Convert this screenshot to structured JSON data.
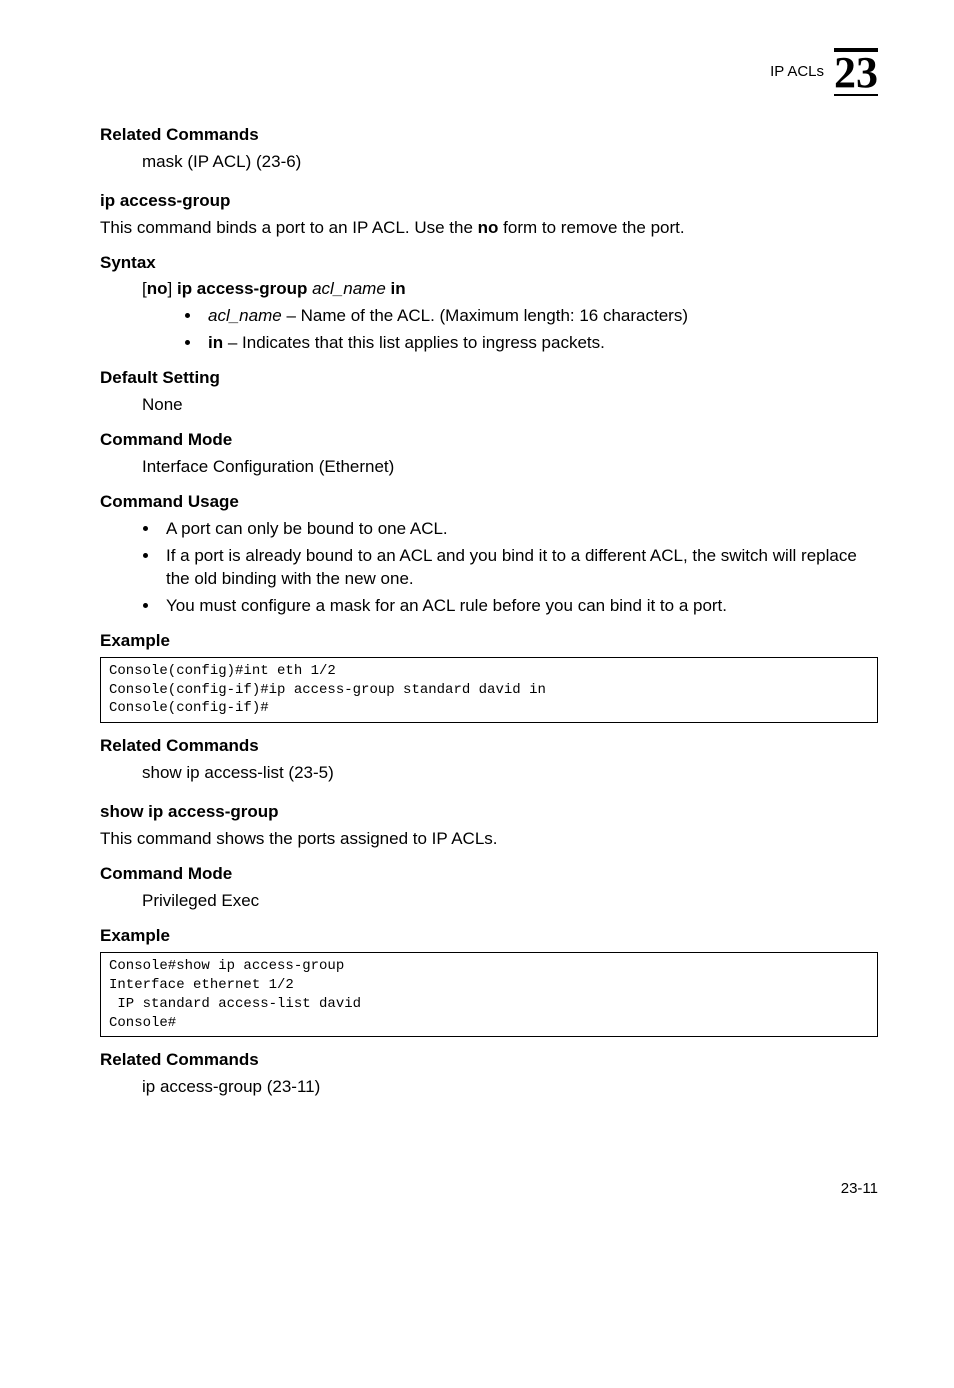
{
  "header": {
    "label": "IP ACLs",
    "chapter": "23"
  },
  "sections": {
    "rc1": {
      "title": "Related Commands",
      "body": "mask (IP ACL) (23-6)"
    },
    "iag": {
      "title": "ip access-group",
      "intro_a": "This command binds a port to an IP ACL. Use the ",
      "intro_b": "no",
      "intro_c": " form to remove the port."
    },
    "syntax": {
      "title": "Syntax",
      "line_prefix": "[",
      "line_no": "no",
      "line_mid1": "] ",
      "line_cmd": "ip access-group",
      "line_arg": " acl_name ",
      "line_in": "in",
      "b1_name": "acl_name",
      "b1_rest": " – Name of the ACL. (Maximum length: 16 characters)",
      "b2_in": "in",
      "b2_rest": " – Indicates that this list applies to ingress packets."
    },
    "def": {
      "title": "Default Setting",
      "body": "None"
    },
    "cmode1": {
      "title": "Command Mode",
      "body": "Interface Configuration (Ethernet)"
    },
    "usage": {
      "title": "Command Usage",
      "b1": "A port can only be bound to one ACL.",
      "b2": "If a port is already bound to an ACL and you bind it to a different ACL, the switch will replace the old binding with the new one.",
      "b3": "You must configure a mask for an ACL rule before you can bind it to a port."
    },
    "ex1": {
      "title": "Example",
      "code": "Console(config)#int eth 1/2\nConsole(config-if)#ip access-group standard david in\nConsole(config-if)#"
    },
    "rc2": {
      "title": "Related Commands",
      "body": "show ip access-list (23-5)"
    },
    "siag": {
      "title": "show ip access-group",
      "intro": "This command shows the ports assigned to IP ACLs."
    },
    "cmode2": {
      "title": "Command Mode",
      "body": "Privileged Exec"
    },
    "ex2": {
      "title": "Example",
      "code": "Console#show ip access-group\nInterface ethernet 1/2\n IP standard access-list david\nConsole#"
    },
    "rc3": {
      "title": "Related Commands",
      "body": "ip access-group (23-11)"
    }
  },
  "footer": {
    "page": "23-11"
  }
}
